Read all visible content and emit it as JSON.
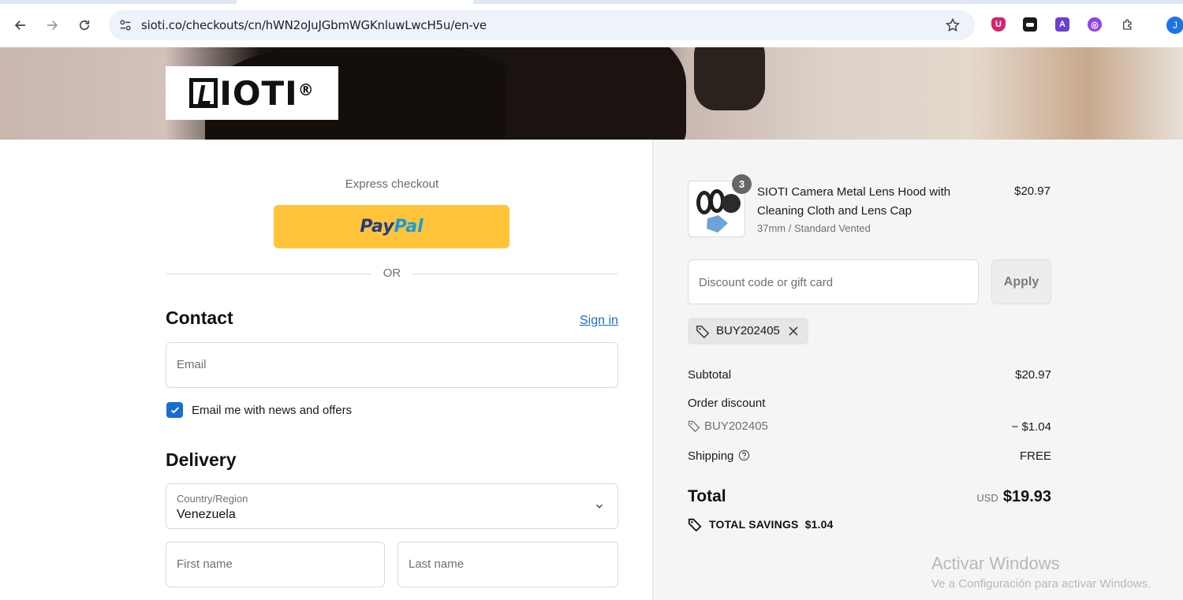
{
  "browser": {
    "url": "sioti.co/checkouts/cn/hWN2oJuJGbmWGKnluwLwcH5u/en-ve",
    "profile_initial": "J"
  },
  "brand": {
    "logo_text": "IOTI",
    "logo_registered": "®"
  },
  "express": {
    "label": "Express checkout",
    "paypal_a": "Pay",
    "paypal_b": "Pal",
    "or_label": "OR"
  },
  "contact": {
    "title": "Contact",
    "signin_label": "Sign in",
    "email_placeholder": "Email",
    "newsletter_label": "Email me with news and offers",
    "newsletter_checked": true
  },
  "delivery": {
    "title": "Delivery",
    "country_label": "Country/Region",
    "country_value": "Venezuela",
    "first_name_placeholder": "First name",
    "last_name_placeholder": "Last name"
  },
  "order": {
    "product_name": "SIOTI Camera Metal Lens Hood with Cleaning Cloth and Lens Cap",
    "product_variant": "37mm / Standard Vented",
    "product_price": "$20.97",
    "quantity": "3",
    "discount_placeholder": "Discount code or gift card",
    "apply_label": "Apply",
    "applied_code": "BUY202405",
    "subtotal_label": "Subtotal",
    "subtotal_value": "$20.97",
    "order_discount_label": "Order discount",
    "discount_code": "BUY202405",
    "discount_value": "− $1.04",
    "shipping_label": "Shipping",
    "shipping_value": "FREE",
    "total_label": "Total",
    "total_currency": "USD",
    "total_value": "$19.93",
    "savings_label": "TOTAL SAVINGS",
    "savings_value": "$1.04"
  },
  "watermark": {
    "line1": "Activar Windows",
    "line2": "Ve a Configuración para activar Windows."
  },
  "colors": {
    "accent": "#1a6ccf",
    "paypal_yellow": "#ffc43a",
    "summary_bg": "#f5f5f5"
  }
}
